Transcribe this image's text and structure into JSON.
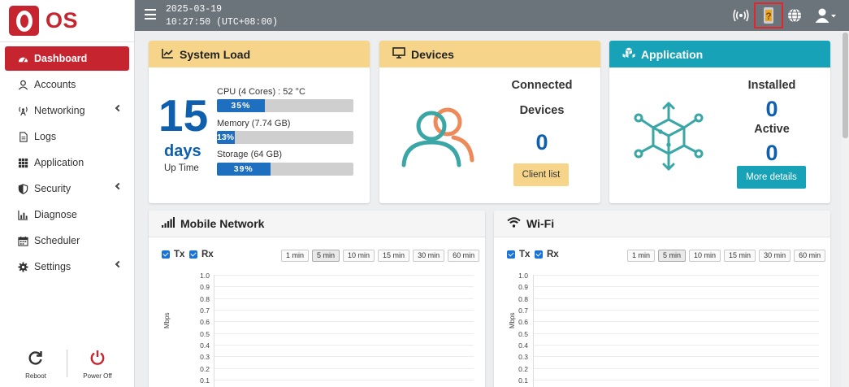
{
  "brand": {
    "name": "OS"
  },
  "sidebar": {
    "items": [
      {
        "label": "Dashboard",
        "icon": "dashboard-icon",
        "active": true,
        "expandable": false
      },
      {
        "label": "Accounts",
        "icon": "user-icon",
        "active": false,
        "expandable": false
      },
      {
        "label": "Networking",
        "icon": "antenna-icon",
        "active": false,
        "expandable": true
      },
      {
        "label": "Logs",
        "icon": "file-icon",
        "active": false,
        "expandable": false
      },
      {
        "label": "Application",
        "icon": "grid-icon",
        "active": false,
        "expandable": false
      },
      {
        "label": "Security",
        "icon": "shield-icon",
        "active": false,
        "expandable": true
      },
      {
        "label": "Diagnose",
        "icon": "chart-icon",
        "active": false,
        "expandable": false
      },
      {
        "label": "Scheduler",
        "icon": "calendar-icon",
        "active": false,
        "expandable": false
      },
      {
        "label": "Settings",
        "icon": "gear-icon",
        "active": false,
        "expandable": true
      }
    ],
    "reboot_label": "Reboot",
    "poweroff_label": "Power Off"
  },
  "topbar": {
    "date": "2025-03-19",
    "time": "10:27:50 (UTC+08:00)",
    "icons": [
      "wireless-icon",
      "help-icon",
      "globe-icon",
      "user-menu-icon"
    ]
  },
  "system_load": {
    "title": "System Load",
    "uptime_value": "15",
    "uptime_unit": "days",
    "uptime_label": "Up Time",
    "cpu_label": "CPU (4 Cores) : 52 °C",
    "cpu_text": "35%",
    "cpu_percent": 35,
    "memory_label": "Memory (7.74 GB)",
    "memory_text": "13%",
    "memory_percent": 13,
    "storage_label": "Storage (64 GB)",
    "storage_text": "39%",
    "storage_percent": 39
  },
  "devices": {
    "title": "Devices",
    "connected_label_1": "Connected",
    "connected_label_2": "Devices",
    "count": "0",
    "client_list_label": "Client list"
  },
  "application": {
    "title": "Application",
    "installed_label": "Installed",
    "installed_count": "0",
    "active_label": "Active",
    "active_count": "0",
    "more_details_label": "More details"
  },
  "mobile_network": {
    "title": "Mobile Network",
    "tx_label": "Tx",
    "rx_label": "Rx",
    "ranges": [
      "1 min",
      "5 min",
      "10 min",
      "15 min",
      "30 min",
      "60 min"
    ],
    "selected_range": "5 min",
    "unit": "Mbps",
    "yticks": [
      "1.0",
      "0.9",
      "0.8",
      "0.7",
      "0.6",
      "0.5",
      "0.4",
      "0.3",
      "0.2",
      "0.1"
    ]
  },
  "wifi": {
    "title": "Wi-Fi",
    "tx_label": "Tx",
    "rx_label": "Rx",
    "ranges": [
      "1 min",
      "5 min",
      "10 min",
      "15 min",
      "30 min",
      "60 min"
    ],
    "selected_range": "5 min",
    "unit": "Mbps",
    "yticks": [
      "1.0",
      "0.9",
      "0.8",
      "0.7",
      "0.6",
      "0.5",
      "0.4",
      "0.3",
      "0.2",
      "0.1"
    ]
  },
  "colors": {
    "brand": "#c6252f",
    "topbar": "#6b737b",
    "yellow_header": "#f6d58b",
    "teal": "#17a2b8",
    "progress": "#1e6fbf",
    "numbers": "#0e5fae",
    "device_icon_teal": "#3aa6a6",
    "device_icon_orange": "#ee8a5a"
  }
}
